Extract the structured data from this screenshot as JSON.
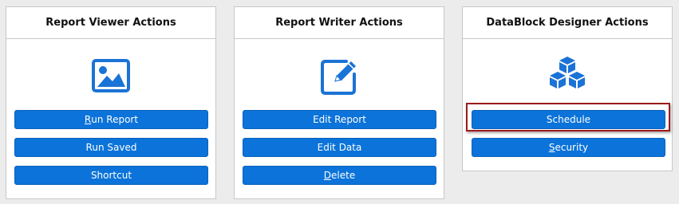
{
  "panels": [
    {
      "title": "Report Viewer Actions",
      "icon": "image-icon",
      "buttons": [
        {
          "pre": "",
          "u": "R",
          "post": "un Report"
        },
        {
          "pre": "Run Saved",
          "u": "",
          "post": ""
        },
        {
          "pre": "Shortcut",
          "u": "",
          "post": ""
        }
      ]
    },
    {
      "title": "Report Writer Actions",
      "icon": "edit-icon",
      "buttons": [
        {
          "pre": "Edit Report",
          "u": "",
          "post": ""
        },
        {
          "pre": "Edit Data",
          "u": "",
          "post": ""
        },
        {
          "pre": "",
          "u": "D",
          "post": "elete"
        }
      ]
    },
    {
      "title": "DataBlock Designer Actions",
      "icon": "cubes-icon",
      "buttons": [
        {
          "pre": "Schedule",
          "u": "",
          "post": ""
        },
        {
          "pre": "",
          "u": "S",
          "post": "ecurity"
        }
      ]
    }
  ],
  "colors": {
    "button": "#0b73d9",
    "icon": "#1a73d6",
    "highlight": "#9b1b1b"
  }
}
